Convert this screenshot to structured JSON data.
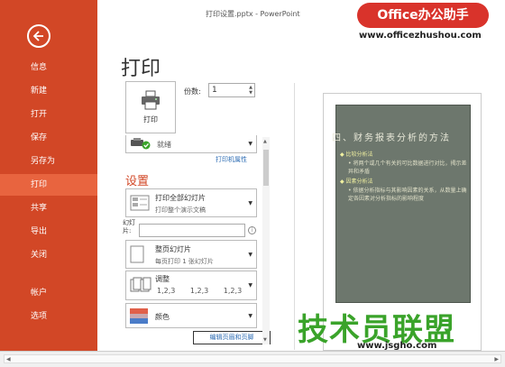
{
  "window": {
    "title": "打印设置.pptx - PowerPoint"
  },
  "nav": {
    "items": [
      {
        "label": "信息",
        "active": false
      },
      {
        "label": "新建",
        "active": false
      },
      {
        "label": "打开",
        "active": false
      },
      {
        "label": "保存",
        "active": false
      },
      {
        "label": "另存为",
        "active": false
      },
      {
        "label": "打印",
        "active": true
      },
      {
        "label": "共享",
        "active": false
      },
      {
        "label": "导出",
        "active": false
      },
      {
        "label": "关闭",
        "active": false
      },
      {
        "label": "帐户",
        "active": false
      },
      {
        "label": "选项",
        "active": false
      }
    ]
  },
  "print": {
    "title": "打印",
    "button_label": "打印",
    "copies_label": "份数:",
    "copies_value": "1",
    "printer_status": "就绪",
    "printer_properties": "打印机属性",
    "settings_title": "设置",
    "range_title": "打印全部幻灯片",
    "range_subtitle": "打印整个演示文稿",
    "slides_label": "幻灯片:",
    "layout_title": "整页幻灯片",
    "layout_subtitle": "每页打印 1 张幻灯片",
    "collate_title": "调整",
    "collate_values": "1,2,3 1,2,3 1,2,3",
    "color_title": "颜色",
    "edit_header_footer": "编辑页眉和页脚"
  },
  "preview": {
    "title": "四、财务报表分析的方法",
    "lines": [
      {
        "text": "◆ 比较分析法",
        "sub": false
      },
      {
        "text": "• 将两个或几个有关的可比数据进行对比，揭示差异和矛盾",
        "sub": true
      },
      {
        "text": "◆ 因素分析法",
        "sub": false
      },
      {
        "text": "• 依据分析指标与其影响因素的关系，从数量上确定各因素对分析指标的影响程度",
        "sub": true
      }
    ]
  },
  "watermarks": {
    "badge": "Office办公助手",
    "url_top": "www.officezhushou.com",
    "big": "技术员联盟",
    "url_bottom": "www.jsgho.com"
  },
  "colors": {
    "nav_bg": "#d24726",
    "nav_active": "#e8643f",
    "accent": "#d24726",
    "link": "#2e6db4"
  }
}
